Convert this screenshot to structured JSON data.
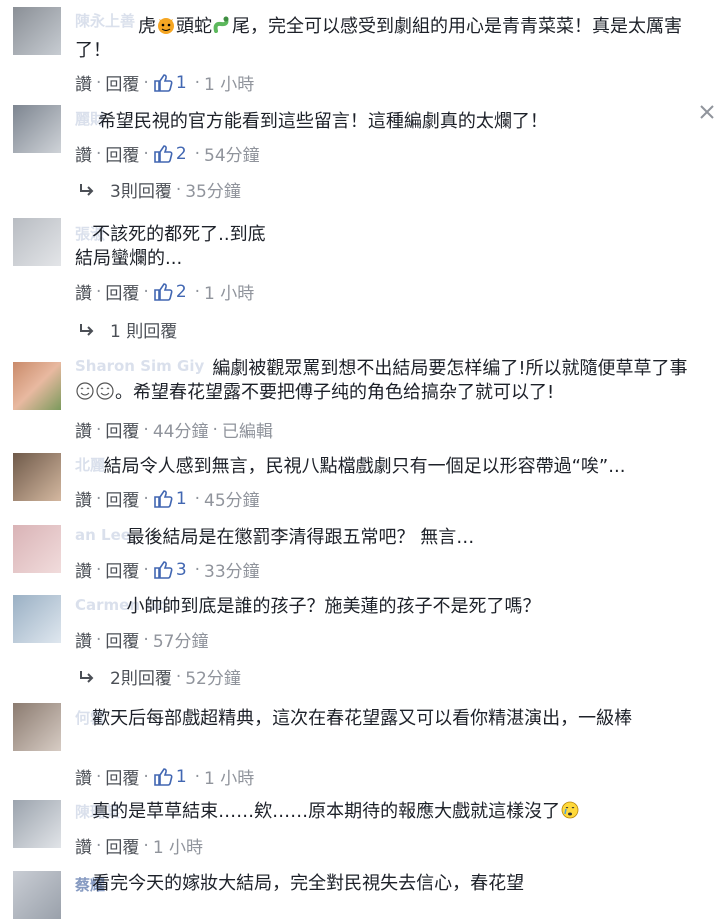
{
  "labels": {
    "like": "讚",
    "reply": "回覆",
    "sep": "·",
    "edited": "已編輯"
  },
  "colors": {
    "link": "#4267b2",
    "text": "#1d2129",
    "meta": "#90949c"
  },
  "comments": [
    {
      "author": "陳永上善",
      "text_a": "虎",
      "text_b": "頭蛇",
      "text_c": "尾，完全可以感受到劇組的用心是青青菜菜！真是太厲害了！",
      "likes": "1",
      "time": "1 小時"
    },
    {
      "author": "麗財",
      "text": "希望民視的官方能看到這些留言！這種編劇真的太爛了！",
      "likes": "2",
      "time": "54分鐘",
      "replies": "3則回覆",
      "replies_time": "35分鐘"
    },
    {
      "author": "張淑",
      "text": "不該死的都死了..到底\n結局蠻爛的...",
      "likes": "2",
      "time": "1 小時",
      "replies": "1 則回覆"
    },
    {
      "author": "Sharon Sim Giy",
      "text_a": "編劇被觀眾罵到想不出結局要怎样编了!所以就隨便草草了事",
      "text_b": "。希望春花望露不要把傅子纯的角色给搞杂了就可以了!",
      "time": "44分鐘",
      "edited": true
    },
    {
      "author": "北麗",
      "text": "結局令人感到無言，民視八點檔戲劇只有一個足以形容帶過“唉”...",
      "likes": "1",
      "time": "45分鐘"
    },
    {
      "author": "an Lee",
      "text": "最後結局是在懲罰李清得跟五常吧？ 無言…",
      "likes": "3",
      "time": "33分鐘"
    },
    {
      "author": "Carmen Go",
      "text": "小帥帥到底是誰的孩子？施美蓮的孩子不是死了嗎？",
      "time": "57分鐘",
      "replies": "2則回覆",
      "replies_time": "52分鐘"
    },
    {
      "author": "何雲",
      "text": "歡天后每部戲超精典，這次在春花望露又可以看你精湛演出，一級棒",
      "likes": "1",
      "time": "1 小時"
    },
    {
      "author": "陳璐某",
      "text": "真的是草草結束……欸……原本期待的報應大戲就這樣沒了",
      "time": "1 小時"
    },
    {
      "author": "蔡耀",
      "text": "看完今天的嫁妝大結局，完全對民視失去信心，春花望"
    }
  ]
}
